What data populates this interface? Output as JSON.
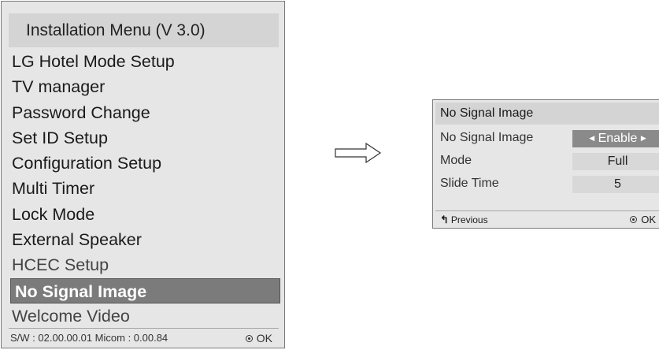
{
  "installation_menu": {
    "title": "Installation Menu (V 3.0)",
    "items": [
      {
        "label": "LG Hotel Mode Setup"
      },
      {
        "label": "TV manager"
      },
      {
        "label": "Password Change"
      },
      {
        "label": "Set ID Setup"
      },
      {
        "label": "Configuration Setup"
      },
      {
        "label": "Multi Timer"
      },
      {
        "label": "Lock Mode"
      },
      {
        "label": "External Speaker"
      },
      {
        "label": "HCEC Setup"
      },
      {
        "label": "No Signal Image",
        "selected": true
      },
      {
        "label": "Welcome Video"
      }
    ],
    "footer": {
      "version": "S/W : 02.00.00.01 Micom : 0.00.84",
      "ok_icon": "ok-button-icon",
      "ok_label": "OK"
    }
  },
  "arrow_icon": "right-arrow-icon",
  "no_signal_panel": {
    "title": "No Signal Image",
    "rows": [
      {
        "label": "No Signal Image",
        "value": "Enable",
        "active": true
      },
      {
        "label": "Mode",
        "value": "Full"
      },
      {
        "label": "Slide Time",
        "value": "5"
      }
    ],
    "footer": {
      "previous_icon": "back-arrow-icon",
      "previous_label": "Previous",
      "ok_icon": "ok-button-icon",
      "ok_label": "OK"
    }
  }
}
